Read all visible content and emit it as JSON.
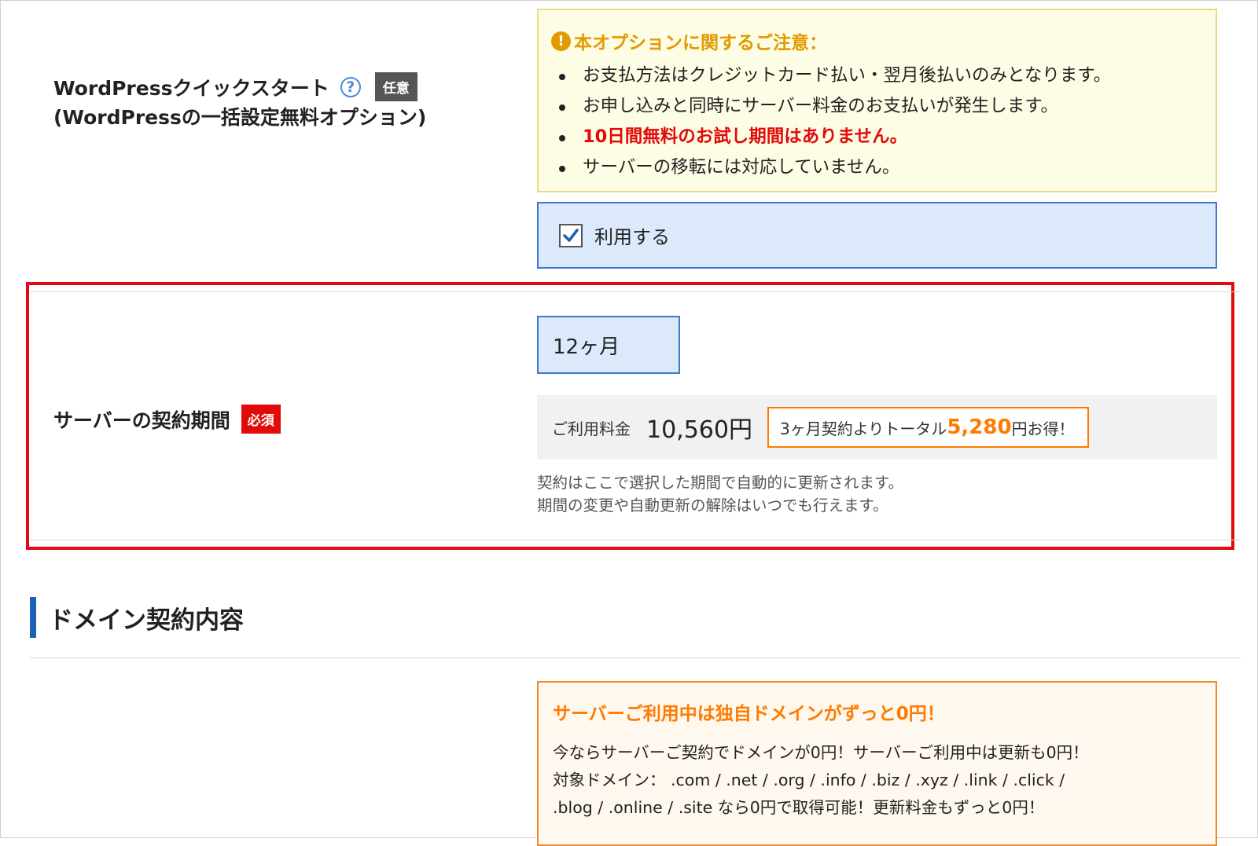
{
  "wordpress_option": {
    "label_line1": "WordPressクイックスタート",
    "help_icon": "?",
    "optional_badge": "任意",
    "label_line2": "(WordPressの一括設定無料オプション)"
  },
  "notice": {
    "icon": "!",
    "title": "本オプションに関するご注意：",
    "items": [
      "お支払方法はクレジットカード払い・翌月後払いのみとなります。",
      "お申し込みと同時にサーバー料金のお支払いが発生します。",
      "10日間無料のお試し期間はありません。",
      "サーバーの移転には対応していません。"
    ]
  },
  "use_option": {
    "label": "利用する",
    "checked": true
  },
  "server_period": {
    "label": "サーバーの契約期間",
    "required_badge": "必須",
    "selected": "12ヶ月",
    "price_label": "ご利用料金",
    "price_value": "10,560円",
    "saving_prefix": "3ヶ月契約よりトータル",
    "saving_amount": "5,280",
    "saving_suffix": "円お得！",
    "note_line1": "契約はここで選択した期間で自動的に更新されます。",
    "note_line2": "期間の変更や自動更新の解除はいつでも行えます。"
  },
  "domain_section": {
    "title": "ドメイン契約内容",
    "promo_title": "サーバーご利用中は独自ドメインがずっと0円！",
    "promo_line1": "今ならサーバーご契約でドメインが0円！サーバーご利用中は更新も0円！",
    "promo_line2": "対象ドメイン：  .com / .net / .org / .info / .biz / .xyz / .link / .click /",
    "promo_line3": ".blog / .online / .site なら0円で取得可能！更新料金もずっと0円！"
  },
  "colors": {
    "highlight_border": "#e30a12",
    "accent_blue": "#3c78cf",
    "warning_orange": "#ff7a00",
    "notice_title": "#e29a00",
    "required_red": "#e30a0a"
  }
}
